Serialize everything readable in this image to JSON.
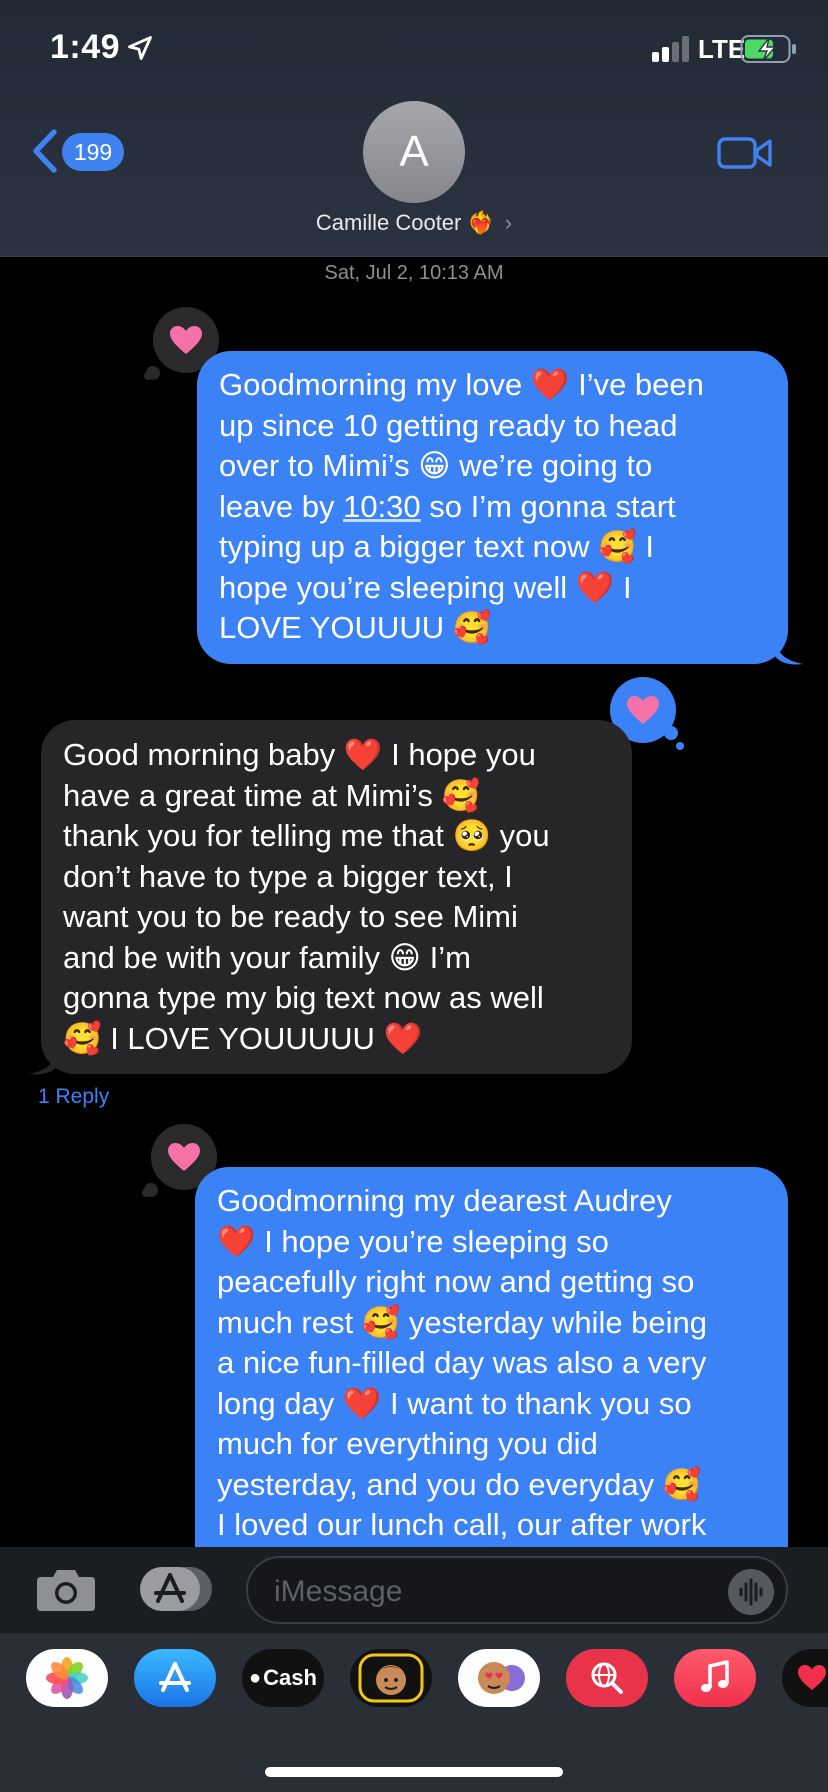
{
  "status_bar": {
    "time": "1:49",
    "network": "LTE"
  },
  "header": {
    "back_count": "199",
    "avatar_initial": "A",
    "contact_name": "Camille Cooter",
    "contact_emoji": "❤️‍🔥"
  },
  "timestamp": "Sat, Jul 2, 10:13 AM",
  "messages": [
    {
      "direction": "outgoing",
      "tapback": "heart",
      "lines": [
        "Goodmorning my love ❤️ I’ve been",
        "up since 10 getting ready to head",
        "over to Mimi’s 😁 we’re going to",
        "leave by ",
        "10:30",
        " so I’m gonna start",
        "typing up a bigger text now 🥰 I",
        "hope you’re sleeping well ❤️ I",
        "LOVE YOUUUU 🥰"
      ]
    },
    {
      "direction": "incoming",
      "tapback": "heart",
      "lines": [
        "Good morning baby ❤️ I hope you",
        "have a great time at Mimi’s 🥰",
        "thank you for telling me that 🥺 you",
        "don’t have to type a bigger text, I",
        "want you to be ready to see Mimi",
        "and be with your family 😁 I’m",
        "gonna type my big text now as well",
        "🥰 I LOVE YOUUUUU ❤️"
      ],
      "reply_label": "1 Reply"
    },
    {
      "direction": "outgoing",
      "tapback": "heart",
      "lines": [
        "Goodmorning my dearest Audrey",
        "❤️ I hope you’re sleeping so",
        "peacefully right now and getting so",
        "much rest 🥰 yesterday while being",
        "a nice fun-filled day was also a very",
        "long day ❤️ I want to thank you so",
        "much for everything you did",
        "yesterday, and you do everyday 🥰",
        "I loved our lunch call, our after work"
      ]
    }
  ],
  "composer": {
    "placeholder": "iMessage"
  },
  "app_drawer": [
    {
      "name": "photos-app",
      "icon": "photos-icon"
    },
    {
      "name": "app-store-app",
      "icon": "app-store-icon"
    },
    {
      "name": "apple-cash-app",
      "label": "Cash"
    },
    {
      "name": "memoji-app",
      "icon": "memoji-icon"
    },
    {
      "name": "memoji-stickers-app",
      "icon": "memoji-stickers-icon"
    },
    {
      "name": "image-search-app",
      "icon": "globe-search-icon"
    },
    {
      "name": "music-app",
      "icon": "music-note-icon"
    },
    {
      "name": "digital-touch-app",
      "icon": "heart-icon"
    }
  ],
  "colors": {
    "accent": "#3b82f6",
    "tapback_heart": "#f472a8"
  }
}
